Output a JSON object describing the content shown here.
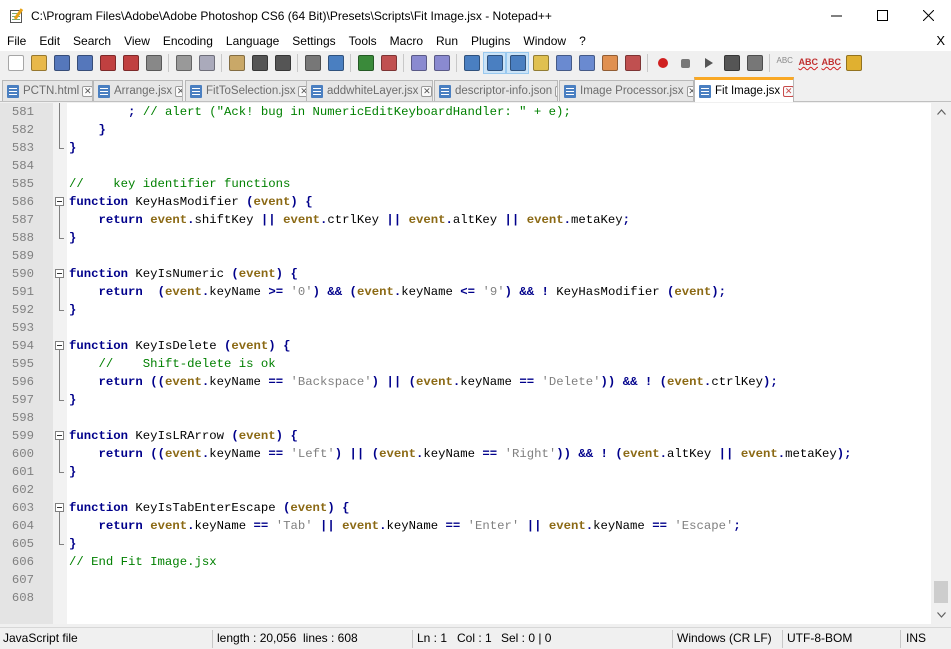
{
  "window": {
    "title": "C:\\Program Files\\Adobe\\Adobe Photoshop CS6 (64 Bit)\\Presets\\Scripts\\Fit Image.jsx - Notepad++"
  },
  "menu": {
    "items": [
      "File",
      "Edit",
      "Search",
      "View",
      "Encoding",
      "Language",
      "Settings",
      "Tools",
      "Macro",
      "Run",
      "Plugins",
      "Window",
      "?"
    ],
    "close": "X"
  },
  "toolbar": {
    "icons": [
      "new-file-icon",
      "open-file-icon",
      "save-icon",
      "save-all-icon",
      "close-icon",
      "close-all-icon",
      "print-icon",
      "cut-icon",
      "copy-icon",
      "paste-icon",
      "undo-icon",
      "redo-icon",
      "find-icon",
      "replace-icon",
      "zoom-in-icon",
      "zoom-out-icon",
      "sync-vertical-icon",
      "sync-horizontal-icon",
      "word-wrap-icon",
      "show-all-chars-icon",
      "indent-guide-icon",
      "udl-icon",
      "doc-map-icon",
      "function-list-icon",
      "folder-workspace-icon",
      "monitor-icon",
      "record-macro-icon",
      "stop-record-icon",
      "play-macro-icon",
      "play-multiple-icon",
      "save-macro-icon",
      "spell-check-icon",
      "spell-abc-icon",
      "spell-abc-alt-icon",
      "highlight-icon"
    ]
  },
  "tabs": [
    {
      "label": "PCTN.html",
      "active": false
    },
    {
      "label": "Arrange.jsx",
      "active": false
    },
    {
      "label": "FitToSelection.jsx",
      "active": false
    },
    {
      "label": "addwhiteLayer.jsx",
      "active": false
    },
    {
      "label": "descriptor-info.json",
      "active": false
    },
    {
      "label": "Image Processor.jsx",
      "active": false
    },
    {
      "label": "Fit Image.jsx",
      "active": true
    }
  ],
  "editor": {
    "lines": [
      {
        "n": "581",
        "fold": "line",
        "seg": [
          [
            "pl",
            "        "
          ],
          [
            "op",
            ";"
          ],
          [
            "cmt",
            " // alert (\"Ack! bug in NumericEditKeyboardHandler: \" + e);"
          ]
        ]
      },
      {
        "n": "582",
        "fold": "line",
        "seg": [
          [
            "pl",
            "    "
          ],
          [
            "op",
            "}"
          ]
        ]
      },
      {
        "n": "583",
        "fold": "end",
        "seg": [
          [
            "op",
            "}"
          ]
        ]
      },
      {
        "n": "584",
        "fold": "none",
        "seg": []
      },
      {
        "n": "585",
        "fold": "none",
        "seg": [
          [
            "cmt",
            "//    key identifier functions"
          ]
        ]
      },
      {
        "n": "586",
        "fold": "start",
        "seg": [
          [
            "kw",
            "function"
          ],
          [
            "pl",
            " KeyHasModifier "
          ],
          [
            "op",
            "("
          ],
          [
            "ev",
            "event"
          ],
          [
            "op",
            ")"
          ],
          [
            "pl",
            " "
          ],
          [
            "op",
            "{"
          ]
        ]
      },
      {
        "n": "587",
        "fold": "line",
        "seg": [
          [
            "pl",
            "    "
          ],
          [
            "kw",
            "return"
          ],
          [
            "pl",
            " "
          ],
          [
            "ev",
            "event"
          ],
          [
            "op",
            "."
          ],
          [
            "pl",
            "shiftKey "
          ],
          [
            "op",
            "||"
          ],
          [
            "pl",
            " "
          ],
          [
            "ev",
            "event"
          ],
          [
            "op",
            "."
          ],
          [
            "pl",
            "ctrlKey "
          ],
          [
            "op",
            "||"
          ],
          [
            "pl",
            " "
          ],
          [
            "ev",
            "event"
          ],
          [
            "op",
            "."
          ],
          [
            "pl",
            "altKey "
          ],
          [
            "op",
            "||"
          ],
          [
            "pl",
            " "
          ],
          [
            "ev",
            "event"
          ],
          [
            "op",
            "."
          ],
          [
            "pl",
            "metaKey"
          ],
          [
            "op",
            ";"
          ]
        ]
      },
      {
        "n": "588",
        "fold": "end",
        "seg": [
          [
            "op",
            "}"
          ]
        ]
      },
      {
        "n": "589",
        "fold": "none",
        "seg": []
      },
      {
        "n": "590",
        "fold": "start",
        "seg": [
          [
            "kw",
            "function"
          ],
          [
            "pl",
            " KeyIsNumeric "
          ],
          [
            "op",
            "("
          ],
          [
            "ev",
            "event"
          ],
          [
            "op",
            ")"
          ],
          [
            "pl",
            " "
          ],
          [
            "op",
            "{"
          ]
        ]
      },
      {
        "n": "591",
        "fold": "line",
        "seg": [
          [
            "pl",
            "    "
          ],
          [
            "kw",
            "return"
          ],
          [
            "pl",
            "  "
          ],
          [
            "op",
            "("
          ],
          [
            "ev",
            "event"
          ],
          [
            "op",
            "."
          ],
          [
            "pl",
            "keyName "
          ],
          [
            "op",
            ">="
          ],
          [
            "pl",
            " "
          ],
          [
            "str",
            "'0'"
          ],
          [
            "op",
            ")"
          ],
          [
            "pl",
            " "
          ],
          [
            "op",
            "&&"
          ],
          [
            "pl",
            " "
          ],
          [
            "op",
            "("
          ],
          [
            "ev",
            "event"
          ],
          [
            "op",
            "."
          ],
          [
            "pl",
            "keyName "
          ],
          [
            "op",
            "<="
          ],
          [
            "pl",
            " "
          ],
          [
            "str",
            "'9'"
          ],
          [
            "op",
            ")"
          ],
          [
            "pl",
            " "
          ],
          [
            "op",
            "&&"
          ],
          [
            "pl",
            " "
          ],
          [
            "op",
            "!"
          ],
          [
            "pl",
            " KeyHasModifier "
          ],
          [
            "op",
            "("
          ],
          [
            "ev",
            "event"
          ],
          [
            "op",
            ")"
          ],
          [
            "op",
            ";"
          ]
        ]
      },
      {
        "n": "592",
        "fold": "end",
        "seg": [
          [
            "op",
            "}"
          ]
        ]
      },
      {
        "n": "593",
        "fold": "none",
        "seg": []
      },
      {
        "n": "594",
        "fold": "start",
        "seg": [
          [
            "kw",
            "function"
          ],
          [
            "pl",
            " KeyIsDelete "
          ],
          [
            "op",
            "("
          ],
          [
            "ev",
            "event"
          ],
          [
            "op",
            ")"
          ],
          [
            "pl",
            " "
          ],
          [
            "op",
            "{"
          ]
        ]
      },
      {
        "n": "595",
        "fold": "line",
        "seg": [
          [
            "pl",
            "    "
          ],
          [
            "cmt",
            "//    Shift-delete is ok"
          ]
        ]
      },
      {
        "n": "596",
        "fold": "line",
        "seg": [
          [
            "pl",
            "    "
          ],
          [
            "kw",
            "return"
          ],
          [
            "pl",
            " "
          ],
          [
            "op",
            "(("
          ],
          [
            "ev",
            "event"
          ],
          [
            "op",
            "."
          ],
          [
            "pl",
            "keyName "
          ],
          [
            "op",
            "=="
          ],
          [
            "pl",
            " "
          ],
          [
            "str",
            "'Backspace'"
          ],
          [
            "op",
            ")"
          ],
          [
            "pl",
            " "
          ],
          [
            "op",
            "||"
          ],
          [
            "pl",
            " "
          ],
          [
            "op",
            "("
          ],
          [
            "ev",
            "event"
          ],
          [
            "op",
            "."
          ],
          [
            "pl",
            "keyName "
          ],
          [
            "op",
            "=="
          ],
          [
            "pl",
            " "
          ],
          [
            "str",
            "'Delete'"
          ],
          [
            "op",
            "))"
          ],
          [
            "pl",
            " "
          ],
          [
            "op",
            "&&"
          ],
          [
            "pl",
            " "
          ],
          [
            "op",
            "!"
          ],
          [
            "pl",
            " "
          ],
          [
            "op",
            "("
          ],
          [
            "ev",
            "event"
          ],
          [
            "op",
            "."
          ],
          [
            "pl",
            "ctrlKey"
          ],
          [
            "op",
            ")"
          ],
          [
            "op",
            ";"
          ]
        ]
      },
      {
        "n": "597",
        "fold": "end",
        "seg": [
          [
            "op",
            "}"
          ]
        ]
      },
      {
        "n": "598",
        "fold": "none",
        "seg": []
      },
      {
        "n": "599",
        "fold": "start",
        "seg": [
          [
            "kw",
            "function"
          ],
          [
            "pl",
            " KeyIsLRArrow "
          ],
          [
            "op",
            "("
          ],
          [
            "ev",
            "event"
          ],
          [
            "op",
            ")"
          ],
          [
            "pl",
            " "
          ],
          [
            "op",
            "{"
          ]
        ]
      },
      {
        "n": "600",
        "fold": "line",
        "seg": [
          [
            "pl",
            "    "
          ],
          [
            "kw",
            "return"
          ],
          [
            "pl",
            " "
          ],
          [
            "op",
            "(("
          ],
          [
            "ev",
            "event"
          ],
          [
            "op",
            "."
          ],
          [
            "pl",
            "keyName "
          ],
          [
            "op",
            "=="
          ],
          [
            "pl",
            " "
          ],
          [
            "str",
            "'Left'"
          ],
          [
            "op",
            ")"
          ],
          [
            "pl",
            " "
          ],
          [
            "op",
            "||"
          ],
          [
            "pl",
            " "
          ],
          [
            "op",
            "("
          ],
          [
            "ev",
            "event"
          ],
          [
            "op",
            "."
          ],
          [
            "pl",
            "keyName "
          ],
          [
            "op",
            "=="
          ],
          [
            "pl",
            " "
          ],
          [
            "str",
            "'Right'"
          ],
          [
            "op",
            "))"
          ],
          [
            "pl",
            " "
          ],
          [
            "op",
            "&&"
          ],
          [
            "pl",
            " "
          ],
          [
            "op",
            "!"
          ],
          [
            "pl",
            " "
          ],
          [
            "op",
            "("
          ],
          [
            "ev",
            "event"
          ],
          [
            "op",
            "."
          ],
          [
            "pl",
            "altKey "
          ],
          [
            "op",
            "||"
          ],
          [
            "pl",
            " "
          ],
          [
            "ev",
            "event"
          ],
          [
            "op",
            "."
          ],
          [
            "pl",
            "metaKey"
          ],
          [
            "op",
            ")"
          ],
          [
            "op",
            ";"
          ]
        ]
      },
      {
        "n": "601",
        "fold": "end",
        "seg": [
          [
            "op",
            "}"
          ]
        ]
      },
      {
        "n": "602",
        "fold": "none",
        "seg": []
      },
      {
        "n": "603",
        "fold": "start",
        "seg": [
          [
            "kw",
            "function"
          ],
          [
            "pl",
            " KeyIsTabEnterEscape "
          ],
          [
            "op",
            "("
          ],
          [
            "ev",
            "event"
          ],
          [
            "op",
            ")"
          ],
          [
            "pl",
            " "
          ],
          [
            "op",
            "{"
          ]
        ]
      },
      {
        "n": "604",
        "fold": "line",
        "seg": [
          [
            "pl",
            "    "
          ],
          [
            "kw",
            "return"
          ],
          [
            "pl",
            " "
          ],
          [
            "ev",
            "event"
          ],
          [
            "op",
            "."
          ],
          [
            "pl",
            "keyName "
          ],
          [
            "op",
            "=="
          ],
          [
            "pl",
            " "
          ],
          [
            "str",
            "'Tab'"
          ],
          [
            "pl",
            " "
          ],
          [
            "op",
            "||"
          ],
          [
            "pl",
            " "
          ],
          [
            "ev",
            "event"
          ],
          [
            "op",
            "."
          ],
          [
            "pl",
            "keyName "
          ],
          [
            "op",
            "=="
          ],
          [
            "pl",
            " "
          ],
          [
            "str",
            "'Enter'"
          ],
          [
            "pl",
            " "
          ],
          [
            "op",
            "||"
          ],
          [
            "pl",
            " "
          ],
          [
            "ev",
            "event"
          ],
          [
            "op",
            "."
          ],
          [
            "pl",
            "keyName "
          ],
          [
            "op",
            "=="
          ],
          [
            "pl",
            " "
          ],
          [
            "str",
            "'Escape'"
          ],
          [
            "op",
            ";"
          ]
        ]
      },
      {
        "n": "605",
        "fold": "end",
        "seg": [
          [
            "op",
            "}"
          ]
        ]
      },
      {
        "n": "606",
        "fold": "none",
        "seg": [
          [
            "cmt",
            "// End Fit Image.jsx"
          ]
        ]
      },
      {
        "n": "607",
        "fold": "none",
        "seg": []
      },
      {
        "n": "608",
        "fold": "none",
        "seg": []
      }
    ]
  },
  "status": {
    "language": "JavaScript file",
    "length": "length : 20,056",
    "lines": "lines : 608",
    "ln": "Ln : 1",
    "col": "Col : 1",
    "sel": "Sel : 0 | 0",
    "eol": "Windows (CR LF)",
    "encoding": "UTF-8-BOM",
    "mode": "INS"
  },
  "colors": {
    "keyword": "#00008b",
    "event": "#8b6914",
    "string": "#808080",
    "comment": "#008000",
    "active_tab_accent": "#f9a825"
  }
}
